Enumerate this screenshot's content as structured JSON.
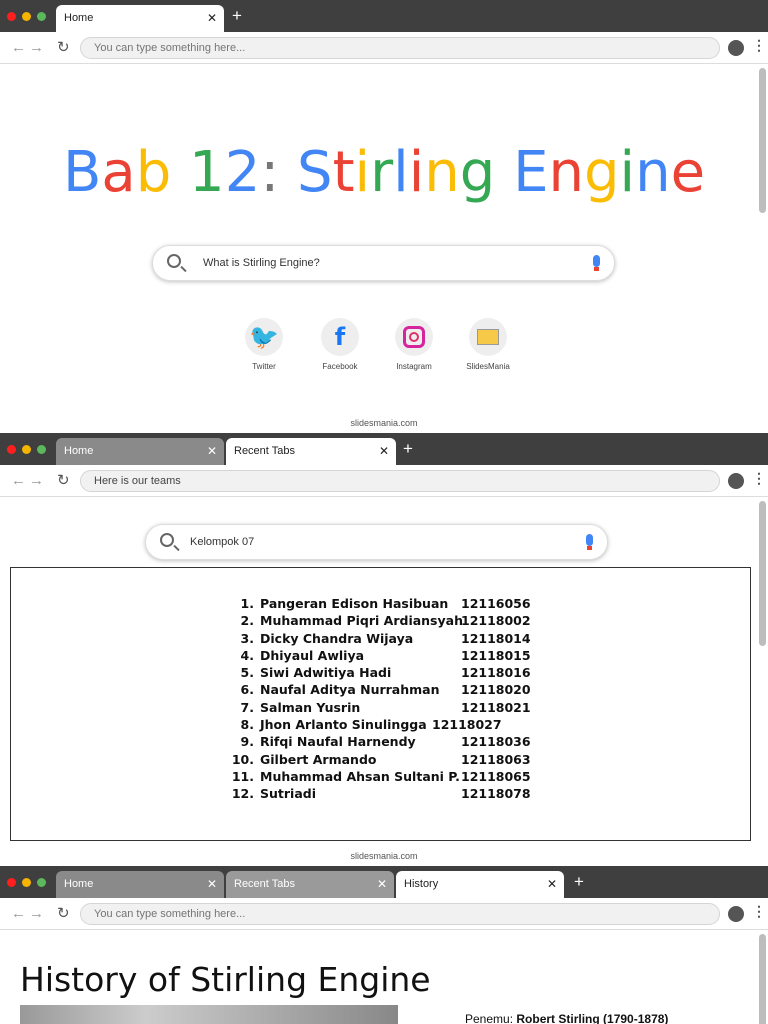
{
  "window_dots": [
    "#ff1f1f",
    "#f5b400",
    "#5cb85c"
  ],
  "panel1": {
    "tabs": [
      {
        "label": "Home"
      }
    ],
    "url_placeholder": "You can type something here...",
    "title_letters": [
      [
        "B",
        "#4285f4"
      ],
      [
        "a",
        "#ea4335"
      ],
      [
        "b",
        "#fbbc05"
      ],
      [
        " ",
        ""
      ],
      [
        "1",
        "#34a853"
      ],
      [
        "2",
        "#4285f4"
      ],
      [
        ":",
        "#777777"
      ],
      [
        " ",
        ""
      ],
      [
        "S",
        "#4285f4"
      ],
      [
        "t",
        "#ea4335"
      ],
      [
        "i",
        "#fbbc05"
      ],
      [
        "r",
        "#34a853"
      ],
      [
        "l",
        "#4285f4"
      ],
      [
        "i",
        "#ea4335"
      ],
      [
        "n",
        "#fbbc05"
      ],
      [
        "g",
        "#34a853"
      ],
      [
        " ",
        ""
      ],
      [
        "E",
        "#4285f4"
      ],
      [
        "n",
        "#ea4335"
      ],
      [
        "g",
        "#fbbc05"
      ],
      [
        "i",
        "#34a853"
      ],
      [
        "n",
        "#4285f4"
      ],
      [
        "e",
        "#ea4335"
      ]
    ],
    "title": "Bab 12: Stirling Engine",
    "search_text": "What is Stirling Engine?",
    "shortcuts": [
      {
        "label": "Twitter",
        "icon": "twitter-icon"
      },
      {
        "label": "Facebook",
        "icon": "facebook-icon"
      },
      {
        "label": "Instagram",
        "icon": "instagram-icon"
      },
      {
        "label": "SlidesMania",
        "icon": "slidesmania-icon"
      }
    ],
    "footer": "slidesmania.com"
  },
  "panel2": {
    "tabs": [
      {
        "label": "Home"
      },
      {
        "label": "Recent Tabs"
      }
    ],
    "url_text": "Here is our teams",
    "search_text": "Kelompok 07",
    "members": [
      {
        "no": "1.",
        "name": "Pangeran Edison Hasibuan",
        "id": "12116056"
      },
      {
        "no": "2.",
        "name": "Muhammad Piqri Ardiansyah",
        "id": "12118002"
      },
      {
        "no": "3.",
        "name": "Dicky Chandra Wijaya",
        "id": "12118014"
      },
      {
        "no": "4.",
        "name": "Dhiyaul Awliya",
        "id": "12118015"
      },
      {
        "no": "5.",
        "name": "Siwi Adwitiya Hadi",
        "id": "12118016"
      },
      {
        "no": "6.",
        "name": "Naufal Aditya Nurrahman",
        "id": "12118020"
      },
      {
        "no": "7.",
        "name": "Salman Yusrin",
        "id": "12118021"
      },
      {
        "no": "8.",
        "name": "Jhon Arlanto Sinulingga",
        "id": "12118027"
      },
      {
        "no": "9.",
        "name": "Rifqi Naufal Harnendy",
        "id": "12118036"
      },
      {
        "no": "10.",
        "name": "Gilbert Armando",
        "id": "12118063"
      },
      {
        "no": "11.",
        "name": "Muhammad Ahsan Sultani P.",
        "id": "12118065"
      },
      {
        "no": "12.",
        "name": "Sutriadi",
        "id": "12118078"
      }
    ],
    "footer": "slidesmania.com"
  },
  "panel3": {
    "tabs": [
      {
        "label": "Home"
      },
      {
        "label": "Recent Tabs"
      },
      {
        "label": "History"
      }
    ],
    "url_placeholder": "You can type something here...",
    "heading": "History of Stirling Engine",
    "inventor_label": "Penemu: ",
    "inventor": "Robert Stirling (1790-1878)"
  }
}
